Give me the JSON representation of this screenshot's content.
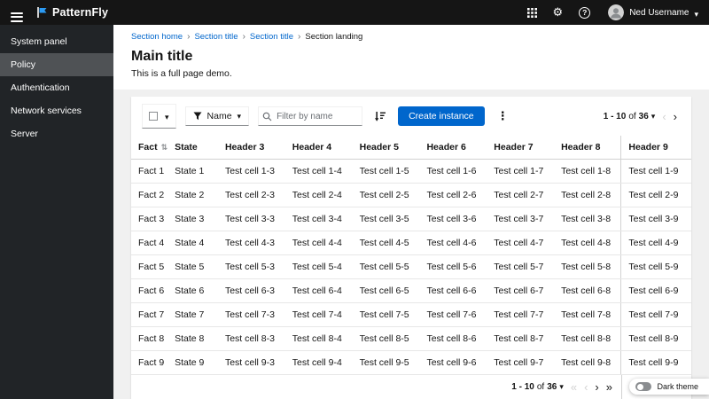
{
  "header": {
    "brand": "PatternFly",
    "user_name": "Ned Username"
  },
  "sidebar": {
    "items": [
      {
        "label": "System panel",
        "current": false
      },
      {
        "label": "Policy",
        "current": true
      },
      {
        "label": "Authentication",
        "current": false
      },
      {
        "label": "Network services",
        "current": false
      },
      {
        "label": "Server",
        "current": false
      }
    ]
  },
  "breadcrumb": {
    "items": [
      {
        "label": "Section home"
      },
      {
        "label": "Section title"
      },
      {
        "label": "Section title"
      },
      {
        "label": "Section landing"
      }
    ]
  },
  "page": {
    "title": "Main title",
    "subtitle": "This is a full page demo."
  },
  "toolbar": {
    "filter_attribute": "Name",
    "search_placeholder": "Filter by name",
    "create_button_label": "Create instance"
  },
  "pagination": {
    "range": "1 - 10",
    "of_label": "of",
    "total": "36"
  },
  "table": {
    "headers": [
      "Fact",
      "State",
      "Header 3",
      "Header 4",
      "Header 5",
      "Header 6",
      "Header 7",
      "Header 8",
      "Header 9"
    ],
    "rows": [
      [
        "Fact 1",
        "State 1",
        "Test cell 1-3",
        "Test cell 1-4",
        "Test cell 1-5",
        "Test cell 1-6",
        "Test cell 1-7",
        "Test cell 1-8",
        "Test cell 1-9"
      ],
      [
        "Fact 2",
        "State 2",
        "Test cell 2-3",
        "Test cell 2-4",
        "Test cell 2-5",
        "Test cell 2-6",
        "Test cell 2-7",
        "Test cell 2-8",
        "Test cell 2-9"
      ],
      [
        "Fact 3",
        "State 3",
        "Test cell 3-3",
        "Test cell 3-4",
        "Test cell 3-5",
        "Test cell 3-6",
        "Test cell 3-7",
        "Test cell 3-8",
        "Test cell 3-9"
      ],
      [
        "Fact 4",
        "State 4",
        "Test cell 4-3",
        "Test cell 4-4",
        "Test cell 4-5",
        "Test cell 4-6",
        "Test cell 4-7",
        "Test cell 4-8",
        "Test cell 4-9"
      ],
      [
        "Fact 5",
        "State 5",
        "Test cell 5-3",
        "Test cell 5-4",
        "Test cell 5-5",
        "Test cell 5-6",
        "Test cell 5-7",
        "Test cell 5-8",
        "Test cell 5-9"
      ],
      [
        "Fact 6",
        "State 6",
        "Test cell 6-3",
        "Test cell 6-4",
        "Test cell 6-5",
        "Test cell 6-6",
        "Test cell 6-7",
        "Test cell 6-8",
        "Test cell 6-9"
      ],
      [
        "Fact 7",
        "State 7",
        "Test cell 7-3",
        "Test cell 7-4",
        "Test cell 7-5",
        "Test cell 7-6",
        "Test cell 7-7",
        "Test cell 7-8",
        "Test cell 7-9"
      ],
      [
        "Fact 8",
        "State 8",
        "Test cell 8-3",
        "Test cell 8-4",
        "Test cell 8-5",
        "Test cell 8-6",
        "Test cell 8-7",
        "Test cell 8-8",
        "Test cell 8-9"
      ],
      [
        "Fact 9",
        "State 9",
        "Test cell 9-3",
        "Test cell 9-4",
        "Test cell 9-5",
        "Test cell 9-6",
        "Test cell 9-7",
        "Test cell 9-8",
        "Test cell 9-9"
      ]
    ]
  },
  "theme_switch": {
    "label": "Dark theme",
    "on": false
  },
  "colors": {
    "masthead_bg": "#151515",
    "sidebar_bg": "#212427",
    "sidebar_current_bg": "#4f5255",
    "primary": "#0066cc",
    "link": "#0066cc",
    "border": "#d2d2d2",
    "page_bg": "#f0f0f0"
  }
}
